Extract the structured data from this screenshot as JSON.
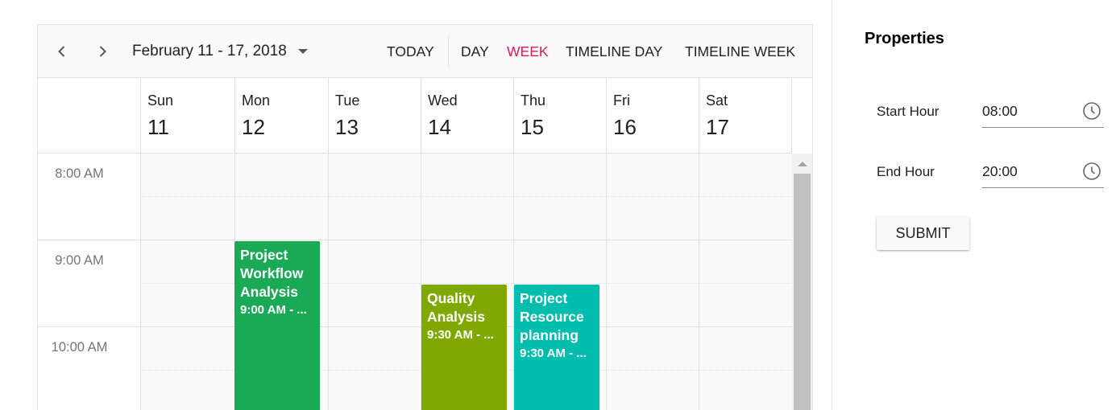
{
  "scheduler": {
    "toolbar": {
      "date_range": "February 11 - 17, 2018",
      "today": "TODAY",
      "views": [
        "DAY",
        "WEEK",
        "TIMELINE DAY",
        "TIMELINE WEEK"
      ],
      "active_view": "WEEK"
    },
    "days": [
      {
        "name": "Sun",
        "num": "11"
      },
      {
        "name": "Mon",
        "num": "12"
      },
      {
        "name": "Tue",
        "num": "13"
      },
      {
        "name": "Wed",
        "num": "14"
      },
      {
        "name": "Thu",
        "num": "15"
      },
      {
        "name": "Fri",
        "num": "16"
      },
      {
        "name": "Sat",
        "num": "17"
      }
    ],
    "times": [
      "8:00 AM",
      "9:00 AM",
      "10:00 AM"
    ],
    "appointments": [
      {
        "subject": "Project Workflow Analysis",
        "time": "9:00 AM - ...",
        "day": 1,
        "start_hour": 9.0,
        "color": "#1aaa55"
      },
      {
        "subject": "Quality Analysis",
        "time": "9:30 AM - ...",
        "day": 3,
        "start_hour": 9.5,
        "color": "#7fa900"
      },
      {
        "subject": "Project Resource planning",
        "time": "9:30 AM - ...",
        "day": 4,
        "start_hour": 9.5,
        "color": "#00bdae"
      }
    ]
  },
  "properties": {
    "title": "Properties",
    "start_hour_label": "Start Hour",
    "start_hour_value": "08:00",
    "end_hour_label": "End Hour",
    "end_hour_value": "20:00",
    "submit_label": "SUBMIT"
  },
  "colors": {
    "accent": "#e3165b"
  }
}
